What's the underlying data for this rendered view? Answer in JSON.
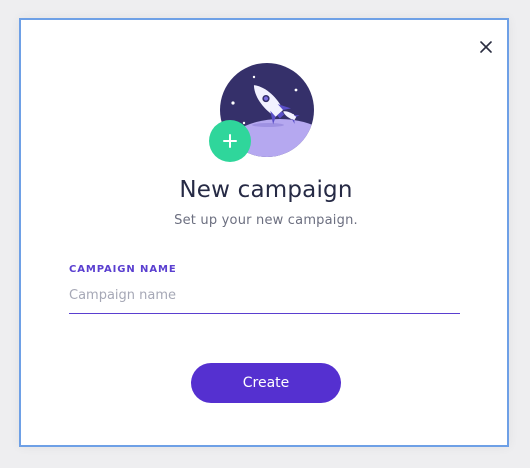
{
  "modal": {
    "title": "New campaign",
    "subtitle": "Set up your new campaign.",
    "close_icon": "close-icon",
    "illustration_icon": "rocket-planet-illustration",
    "add_icon": "plus-icon"
  },
  "form": {
    "campaign_name": {
      "label": "CAMPAIGN NAME",
      "value": "",
      "placeholder": "Campaign name"
    }
  },
  "actions": {
    "create_label": "Create"
  },
  "colors": {
    "accent": "#5530d0",
    "modal_border": "#6ea0e6",
    "planet_dark": "#35306a",
    "planet_light": "#b5a8f0",
    "add_badge": "#2fd69b",
    "title_text": "#262a45",
    "subtitle_text": "#6c6f80"
  }
}
